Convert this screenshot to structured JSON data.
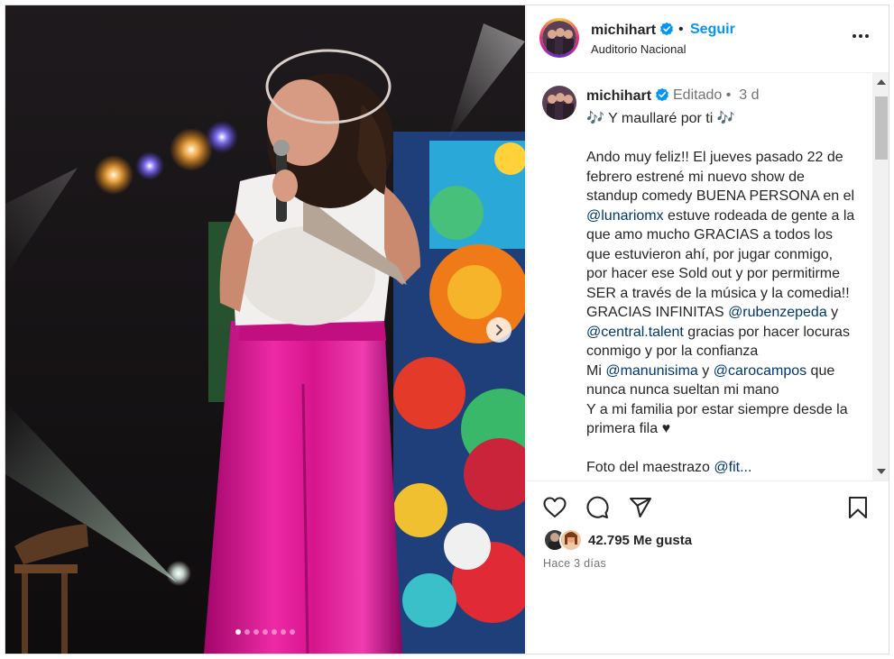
{
  "header": {
    "username": "michihart",
    "separator": "•",
    "follow_label": "Seguir",
    "location": "Auditorio Nacional"
  },
  "caption": {
    "username": "michihart",
    "edited": "Editado",
    "dot": "•",
    "age": "3 d",
    "line_title": "🎶 Y maullaré por ti 🎶",
    "para1": "Ando muy feliz!! El jueves pasado 22 de febrero estrené mi nuevo show de standup comedy BUENA PERSONA en el ",
    "mention_lunario": "@lunariomx",
    "para1b": " estuve rodeada de gente a la que amo mucho GRACIAS a todos los que estuvieron ahí, por jugar conmigo, por hacer ese Sold out y por permitirme SER a través de la música y la comedia!!",
    "para2a": "GRACIAS INFINITAS ",
    "mention_ruben": "@rubenzepeda",
    "para2b": " y ",
    "mention_central": "@central.talent",
    "para2c": " gracias por hacer locuras conmigo y por la confianza",
    "para3a": "Mi ",
    "mention_manu": "@manunisima",
    "para3b": " y ",
    "mention_caro": "@carocampos",
    "para3c": " que nunca nunca sueltan mi mano",
    "para4": "Y a mi familia por estar siempre desde la primera fila ♥",
    "para5": "Foto del maestrazo ",
    "mention_photo": "@fit..."
  },
  "likes": {
    "count_text": "42.795 Me gusta"
  },
  "timestamp": "Hace 3 días",
  "carousel": {
    "total": 7,
    "active_index": 0
  },
  "colors": {
    "link_blue": "#0095f6",
    "mention_blue": "#00376b",
    "verified": "#0095f6",
    "pants_pink": "#d6148c"
  },
  "icons": {
    "verified": "verified-badge-icon",
    "like": "heart-icon",
    "comment": "comment-icon",
    "share": "paper-plane-icon",
    "save": "bookmark-icon",
    "more": "more-options-icon",
    "next": "chevron-right-icon"
  }
}
